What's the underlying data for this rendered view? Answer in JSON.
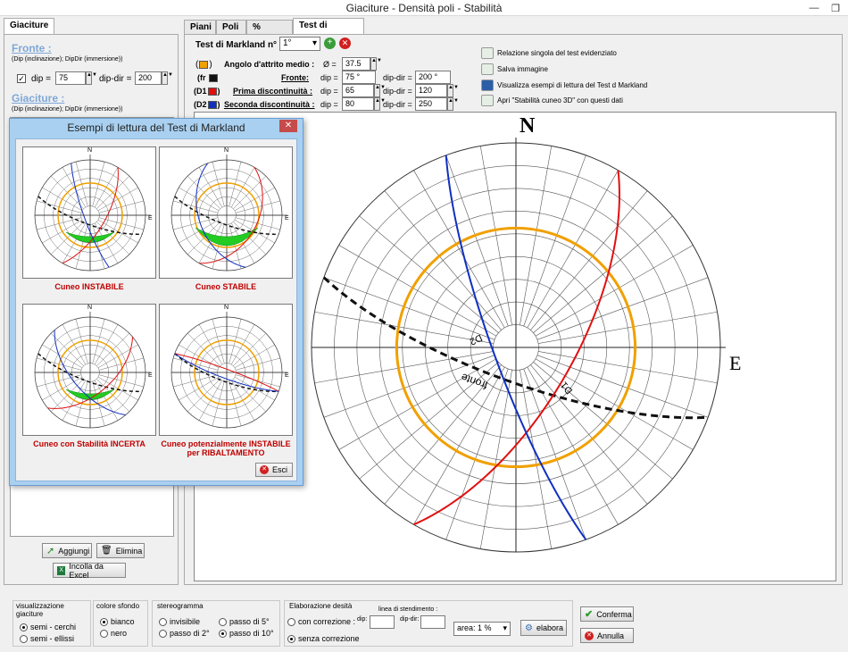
{
  "window": {
    "title": "Giaciture - Densità poli - Stabilità",
    "controls": [
      "—",
      "❐",
      "✕"
    ]
  },
  "left_tab": "Giaciture",
  "left": {
    "fronte_title": "Fronte :",
    "fronte_desc": "(Dip (inclinazione); DipDir (immersione))",
    "dip_label": "dip =",
    "dip_value": "75",
    "dipdir_label": "dip-dir =",
    "dipdir_value": "200",
    "giaciture_title": "Giaciture :",
    "giaciture_desc": "(Dip (inclinazione); DipDir (immersione))",
    "aggiungi": "Aggiungi",
    "elimina": "Elimina",
    "incolla": "Incolla da Excel"
  },
  "tabs": [
    "Piani",
    "Poli",
    "% Densità",
    "Test di Markland"
  ],
  "markland": {
    "test_label": "Test di Markland n° =",
    "test_value": "1°",
    "attrito_label": "Angolo d'attrito medio :",
    "phi_label": "Ø =",
    "phi_value": "37.5",
    "fr_prefix": "(fr",
    "d1_prefix": "(D1",
    "d2_prefix": "(D2",
    "fronte_label": "Fronte:",
    "prima_label": "Prima discontinuità :",
    "seconda_label": "Seconda discontinuità :",
    "dip_eq": "dip =",
    "dipdir_eq": "dip-dir =",
    "fr_dip": "75 °",
    "fr_dipdir": "200 °",
    "d1_dip": "65",
    "d1_dipdir": "120",
    "d2_dip": "80",
    "d2_dipdir": "250"
  },
  "actions": [
    "Relazione singola del test evidenziato",
    "Salva immagine",
    "Visualizza esempi di lettura del Test d Markland",
    "Apri \"Stabilità cuneo 3D\" con questi dati"
  ],
  "stereo": {
    "north": "N",
    "east": "E",
    "label_d2": "D2",
    "label_fronte": "fronte",
    "label_d1": "D1"
  },
  "dialog": {
    "title": "Esempi di lettura del Test di Markland",
    "close": "✕",
    "captions": [
      "Cuneo INSTABILE",
      "Cuneo STABILE",
      "Cuneo con Stabilità INCERTA",
      "Cuneo potenzialmente INSTABILE per RIBALTAMENTO"
    ],
    "thumb_n": "N",
    "thumb_e": "E",
    "esci": "Esci"
  },
  "bottom": {
    "vis_title": "visualizzazione giaciture",
    "vis_opts": [
      "semi - cerchi",
      "semi - ellissi"
    ],
    "sfondo_title": "colore sfondo",
    "sfondo_opts": [
      "bianco",
      "nero"
    ],
    "stereo_title": "stereogramma",
    "stereo_opts": [
      "invisibile",
      "passo di 2°",
      "passo di 5°",
      "passo di 10°"
    ],
    "elab_title": "Elaborazione desità",
    "con_corr": "con correzione :",
    "senza_corr": "senza correzione",
    "linea": "linea di stendimento :",
    "dip_lbl": "dip:",
    "dipdir_lbl": "dip-dir:",
    "area_label": "area:",
    "area_value": "1 %",
    "elabora": "elabora",
    "conferma": "Conferma",
    "annulla": "Annulla"
  },
  "colors": {
    "fronte": "#111111",
    "d1": "#e01010",
    "d2": "#1030c0",
    "attrito": "#f0a000"
  }
}
